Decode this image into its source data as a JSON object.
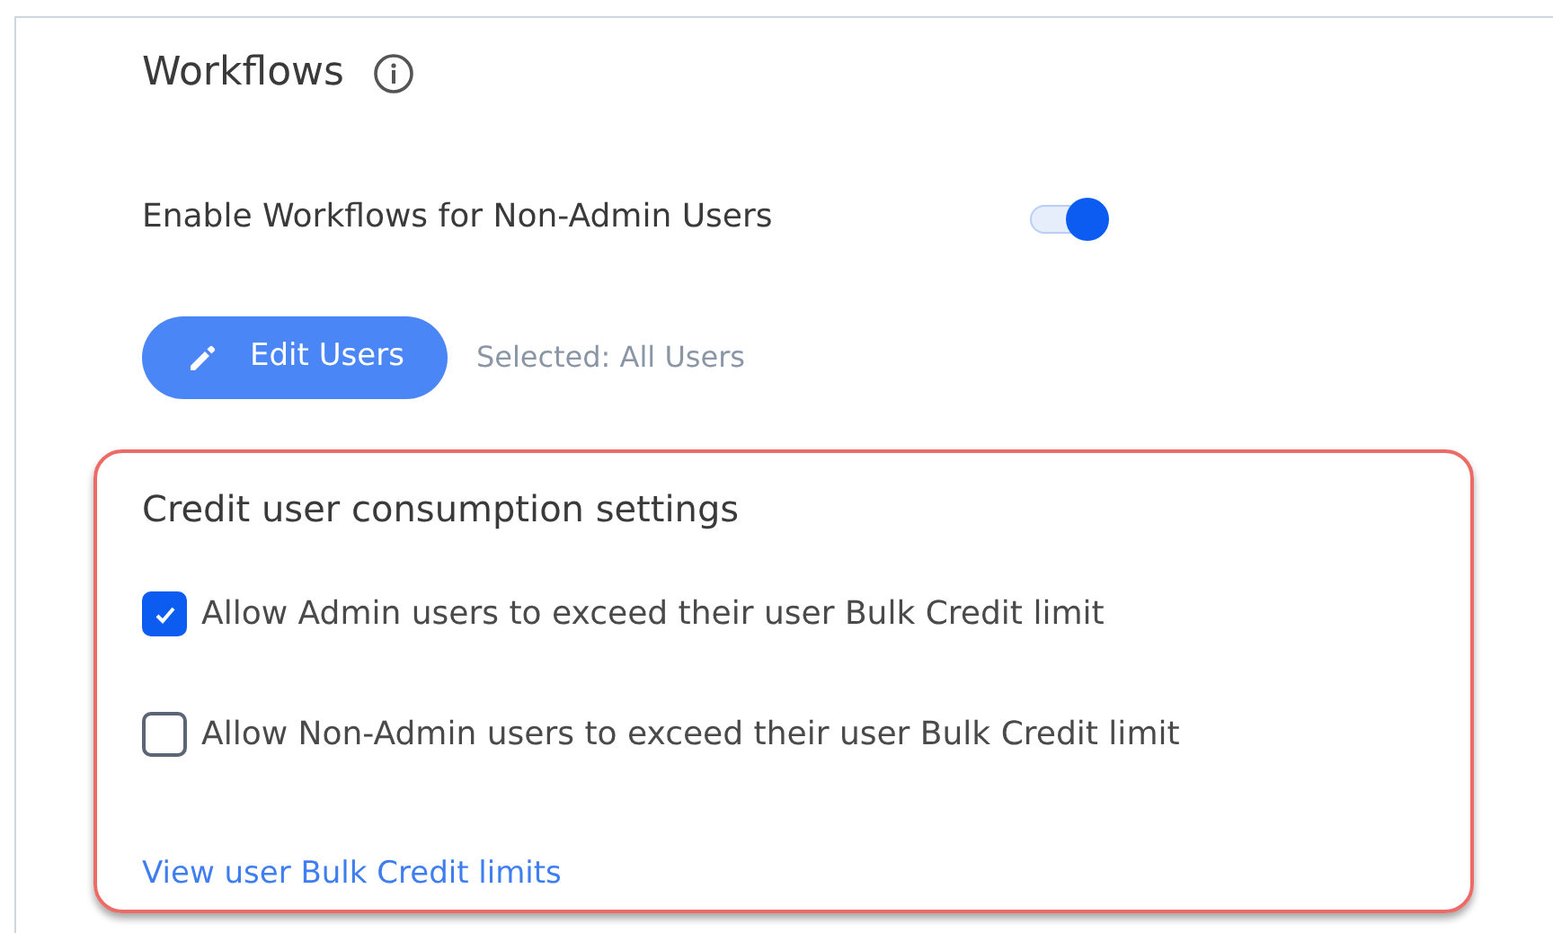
{
  "section": {
    "title": "Workflows"
  },
  "toggle": {
    "label": "Enable Workflows for Non-Admin Users",
    "on": true
  },
  "edit_button": {
    "label": "Edit Users"
  },
  "selection": "Selected: All Users",
  "credit_settings": {
    "title": "Credit user consumption settings",
    "options": [
      {
        "label": "Allow Admin users to exceed their user Bulk Credit limit",
        "checked": true
      },
      {
        "label": "Allow Non-Admin users to exceed their user Bulk Credit limit",
        "checked": false
      }
    ],
    "link": "View user Bulk Credit limits"
  }
}
